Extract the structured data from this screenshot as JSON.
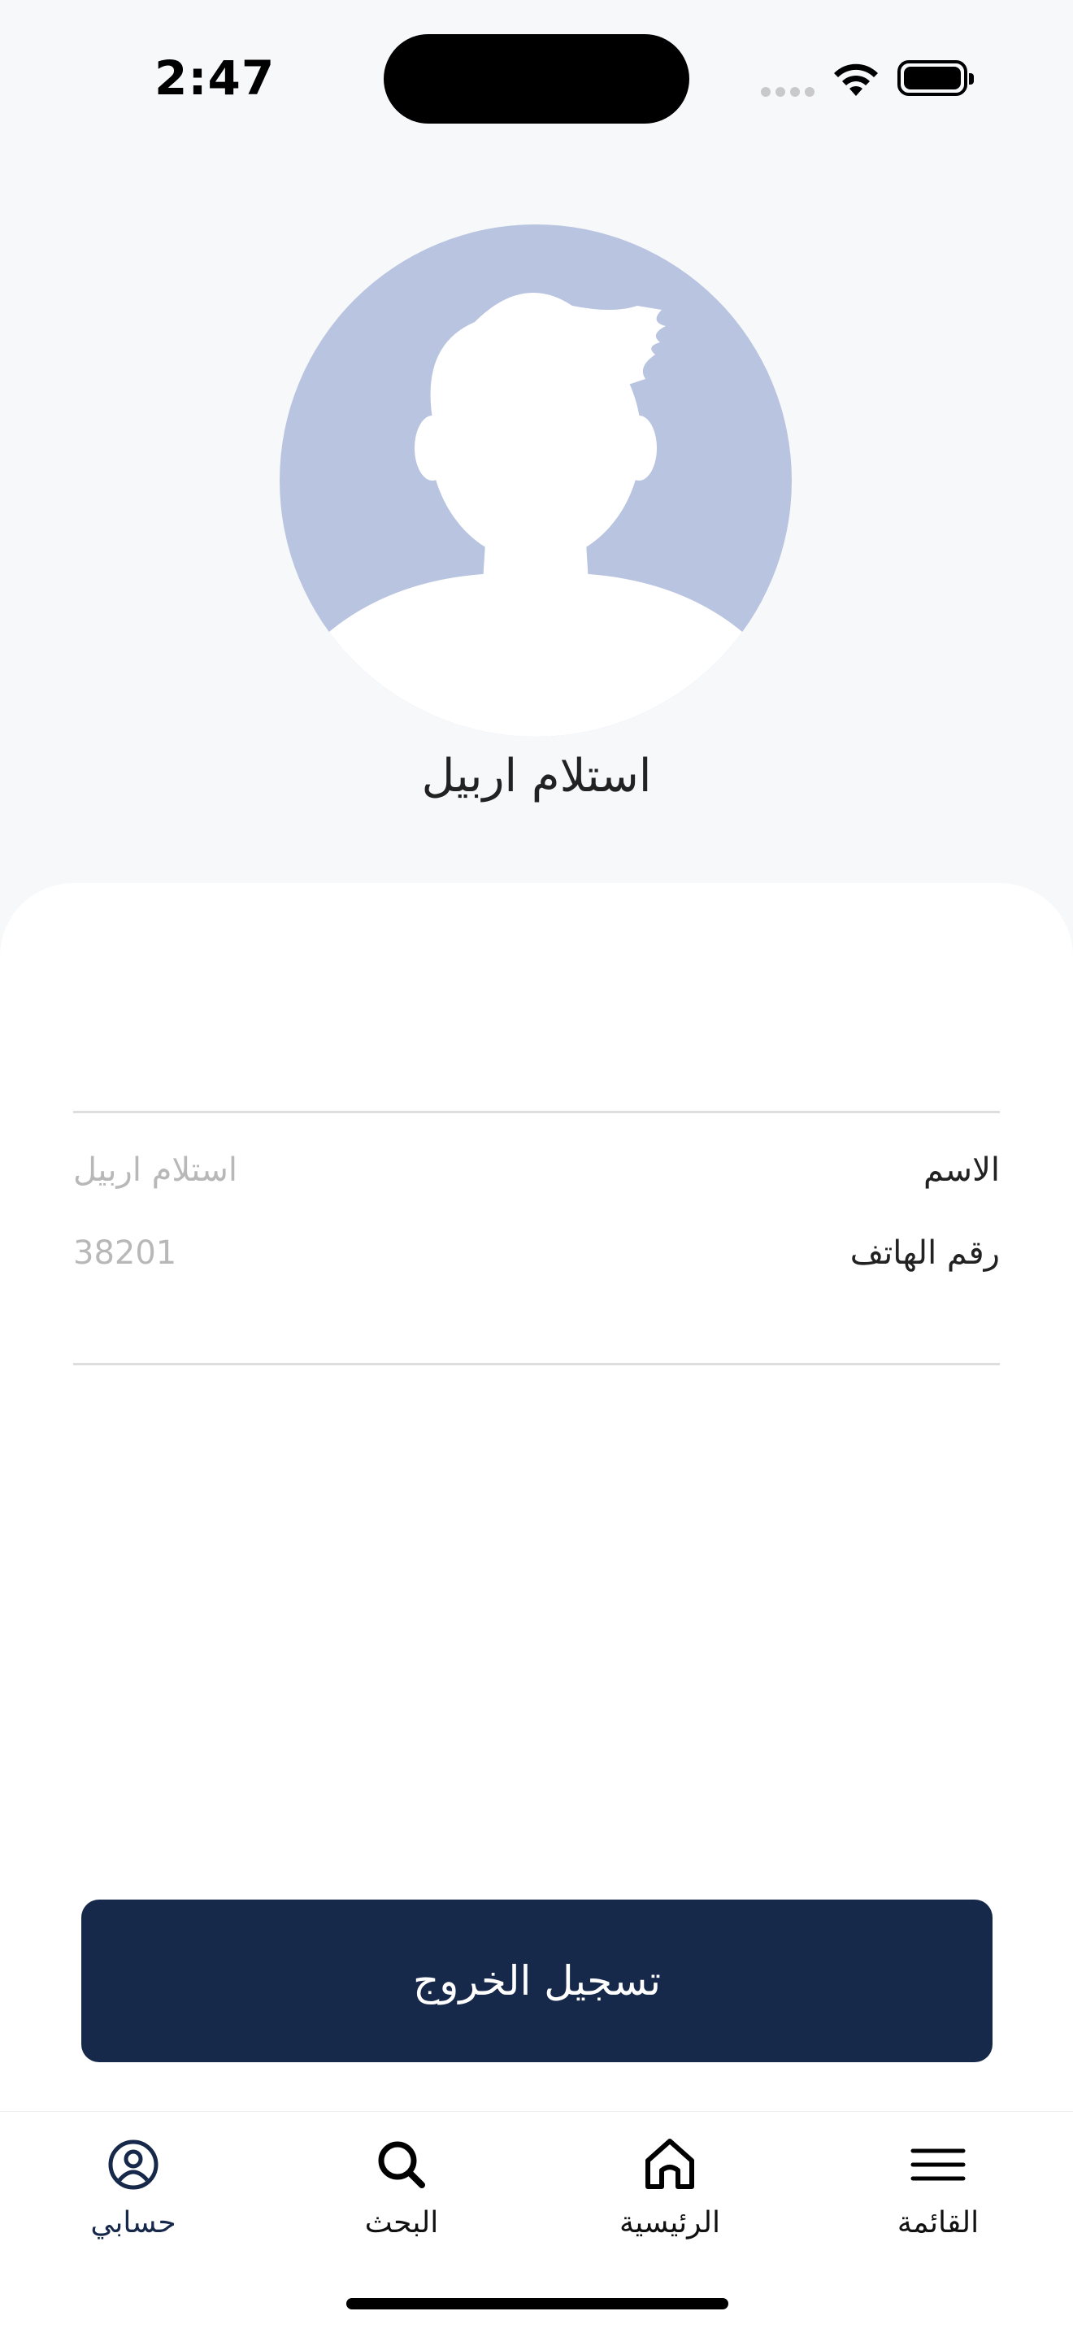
{
  "status": {
    "time": "2:47"
  },
  "profile": {
    "display_name": "استلام اربيل"
  },
  "details": [
    {
      "label": "الاسم",
      "value": "استلام اربيل"
    },
    {
      "label": "رقم الهاتف",
      "value": "38201"
    }
  ],
  "actions": {
    "logout_label": "تسجيل الخروج"
  },
  "tabbar": {
    "items": [
      {
        "label": "حسابي",
        "icon": "account-icon",
        "active": true
      },
      {
        "label": "البحث",
        "icon": "search-icon"
      },
      {
        "label": "الرئيسية",
        "icon": "home-icon"
      },
      {
        "label": "القائمة",
        "icon": "menu-icon"
      }
    ]
  },
  "colors": {
    "primary": "#17294a",
    "avatar_bg": "#b8c4e0",
    "page_bg": "#f7f8fa"
  }
}
